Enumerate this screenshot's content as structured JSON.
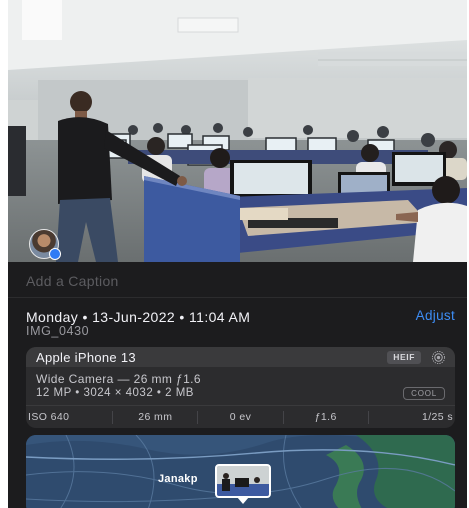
{
  "photo": {
    "subject_icon": "person-avatar"
  },
  "caption": {
    "placeholder": "Add a Caption"
  },
  "info": {
    "datetime": "Monday • 13-Jun-2022 • 11:04 AM",
    "filename": "IMG_0430",
    "adjust_label": "Adjust"
  },
  "camera": {
    "device": "Apple iPhone 13",
    "format_badge": "HEIF",
    "live_icon": "live-photo-icon",
    "lens": "Wide Camera — 26 mm ƒ1.6",
    "specs": "12 MP • 3024 × 4032 • 2 MB",
    "style_badge": "COOL",
    "exif": [
      "ISO 640",
      "26 mm",
      "0 ev",
      "ƒ1.6",
      "1/25 s"
    ]
  },
  "map": {
    "place_label": "Janakp"
  },
  "colors": {
    "panel_bg": "#1c1c1e",
    "card_bg": "#2c2c2e",
    "accent": "#3d8df5"
  }
}
